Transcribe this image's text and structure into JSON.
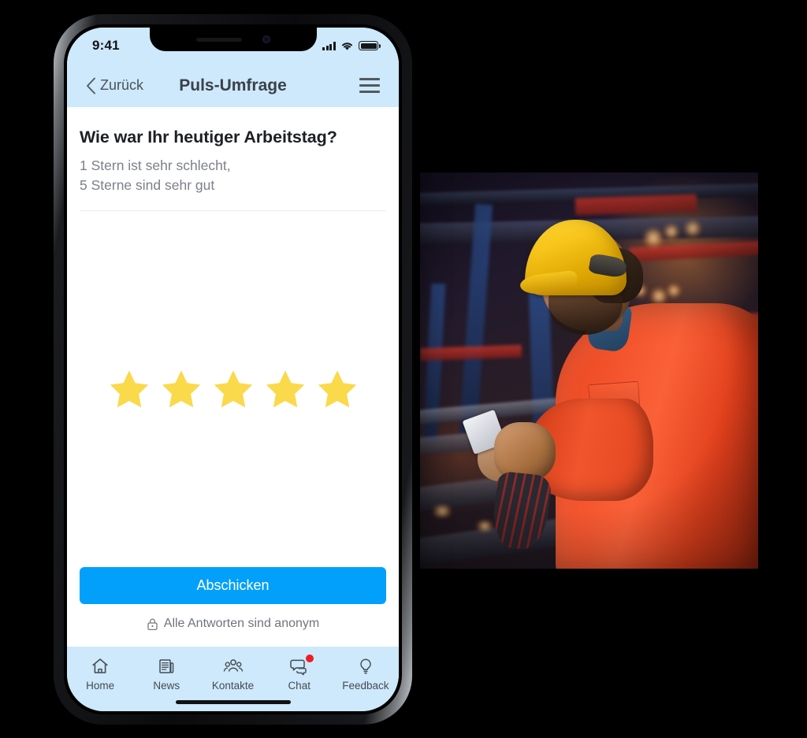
{
  "app": {
    "accent_blue": "#03a0fb",
    "header_blue": "#cde9fb",
    "star_yellow": "#fad94b",
    "badge_red": "#f01c24"
  },
  "status_bar": {
    "time": "9:41",
    "signal_icon": "cellular-signal-icon",
    "wifi_icon": "wifi-icon",
    "battery_icon": "battery-icon"
  },
  "nav": {
    "back_label": "Zurück",
    "back_icon": "chevron-left-icon",
    "title": "Puls-Umfrage",
    "menu_icon": "hamburger-menu-icon"
  },
  "survey": {
    "question": "Wie war Ihr heutiger Arbeitstag?",
    "hint_line1": "1 Stern ist sehr schlecht,",
    "hint_line2": "5 Sterne sind sehr gut",
    "rating": {
      "max": 5,
      "selected": 5,
      "stars": [
        {
          "index": 1,
          "filled": true
        },
        {
          "index": 2,
          "filled": true
        },
        {
          "index": 3,
          "filled": true
        },
        {
          "index": 4,
          "filled": true
        },
        {
          "index": 5,
          "filled": true
        }
      ]
    },
    "submit_label": "Abschicken",
    "anonymous_note": "Alle Antworten sind anonym",
    "anonymous_icon": "lock-icon"
  },
  "tabs": [
    {
      "id": "home",
      "label": "Home",
      "icon": "home-icon",
      "badge": false
    },
    {
      "id": "news",
      "label": "News",
      "icon": "newspaper-icon",
      "badge": false
    },
    {
      "id": "kontakte",
      "label": "Kontakte",
      "icon": "people-icon",
      "badge": false
    },
    {
      "id": "chat",
      "label": "Chat",
      "icon": "chat-bubbles-icon",
      "badge": true
    },
    {
      "id": "feedback",
      "label": "Feedback",
      "icon": "lightbulb-icon",
      "badge": false
    }
  ],
  "photo": {
    "alt": "Industriearbeiter mit gelbem Schutzhelm und orangefarbener Arbeitsjacke benutzt ein Smartphone in einer Werkhalle"
  }
}
